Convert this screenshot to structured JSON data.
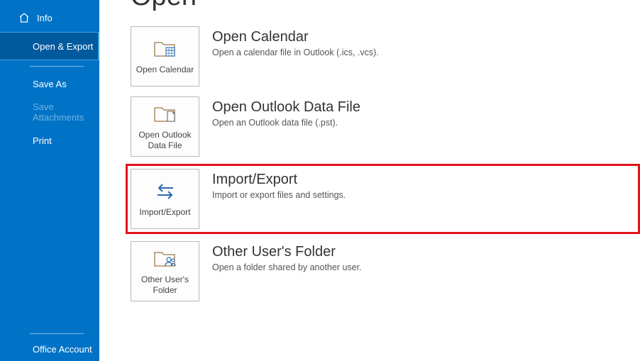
{
  "colors": {
    "sidebar_bg": "#0173c7",
    "sidebar_selected_bg": "#015a9e",
    "highlight_border": "#e2131b"
  },
  "sidebar": {
    "items": [
      {
        "label": "Info",
        "icon": "home"
      },
      {
        "label": "Open & Export",
        "selected": true
      },
      {
        "label": "Save As"
      },
      {
        "label": "Save Attachments",
        "disabled": true
      },
      {
        "label": "Print"
      }
    ],
    "bottom": {
      "label": "Office Account"
    }
  },
  "page": {
    "title": "Open",
    "options": [
      {
        "tile_label": "Open Calendar",
        "title": "Open Calendar",
        "desc": "Open a calendar file in Outlook (.ics, .vcs).",
        "icon": "calendar"
      },
      {
        "tile_label": "Open Outlook Data File",
        "title": "Open Outlook Data File",
        "desc": "Open an Outlook data file (.pst).",
        "icon": "datafile"
      },
      {
        "tile_label": "Import/Export",
        "title": "Import/Export",
        "desc": "Import or export files and settings.",
        "icon": "importexport",
        "highlighted": true
      },
      {
        "tile_label": "Other User's Folder",
        "title": "Other User's Folder",
        "desc": "Open a folder shared by another user.",
        "icon": "userfolder"
      }
    ]
  }
}
